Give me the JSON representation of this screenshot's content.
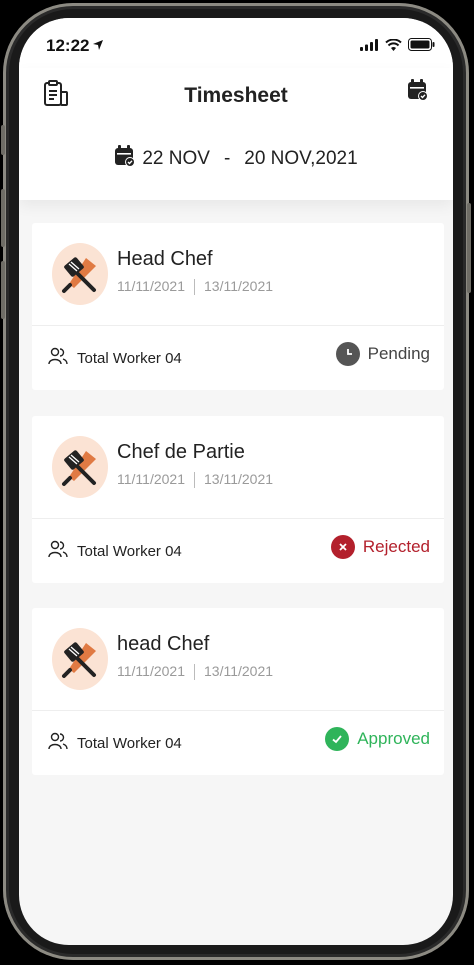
{
  "status_bar": {
    "time": "12:22"
  },
  "header": {
    "title": "Timesheet",
    "range_start": "22 NOV",
    "range_sep": "-",
    "range_end": "20 NOV,2021"
  },
  "cards": [
    {
      "role": "Head Chef",
      "date_from": "11/11/2021",
      "date_to": "13/11/2021",
      "workers": "Total Worker 04",
      "status": "Pending",
      "status_color": "#555555"
    },
    {
      "role": "Chef de Partie",
      "date_from": "11/11/2021",
      "date_to": "13/11/2021",
      "workers": "Total Worker 04",
      "status": "Rejected",
      "status_color": "#b3202c"
    },
    {
      "role": "head Chef",
      "date_from": "11/11/2021",
      "date_to": "13/11/2021",
      "workers": "Total Worker 04",
      "status": "Approved",
      "status_color": "#2fb45a"
    }
  ]
}
